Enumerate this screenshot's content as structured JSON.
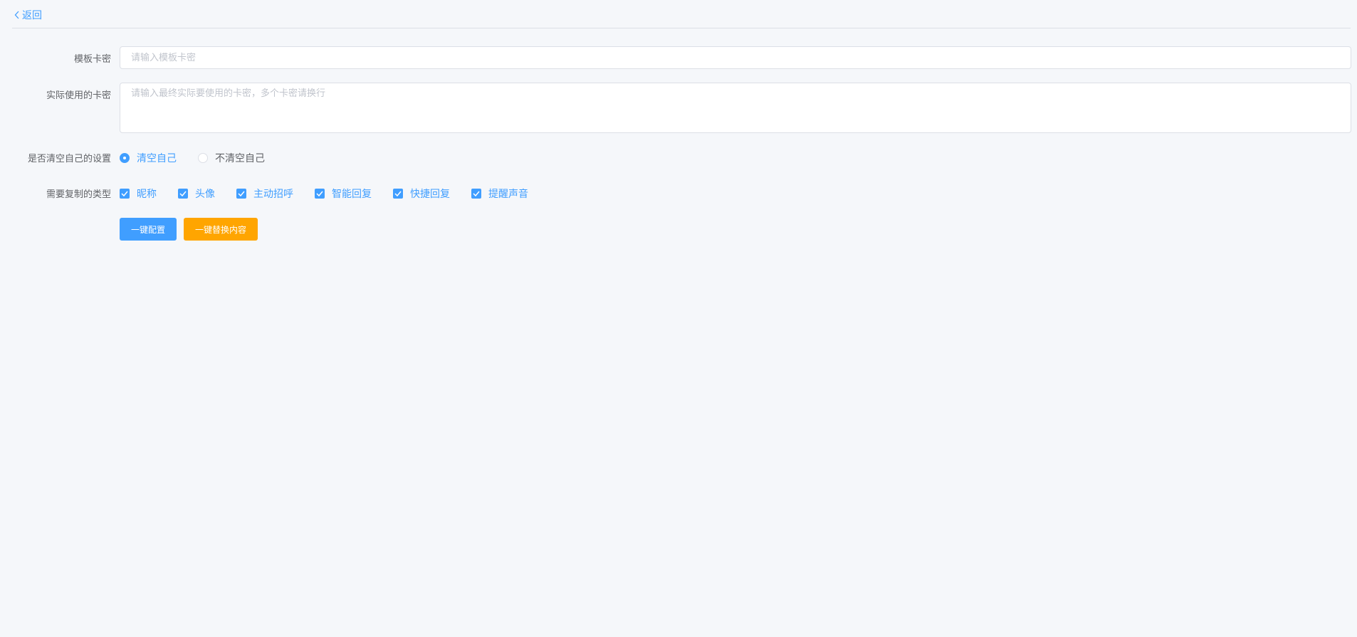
{
  "nav": {
    "back_label": "返回"
  },
  "form": {
    "template_card": {
      "label": "模板卡密",
      "placeholder": "请输入模板卡密",
      "value": ""
    },
    "actual_cards": {
      "label": "实际使用的卡密",
      "placeholder": "请输入最终实际要使用的卡密，多个卡密请换行",
      "value": ""
    },
    "clear_self": {
      "label": "是否清空自己的设置",
      "options": [
        {
          "label": "清空自己",
          "selected": true
        },
        {
          "label": "不清空自己",
          "selected": false
        }
      ]
    },
    "copy_types": {
      "label": "需要复制的类型",
      "options": [
        {
          "label": "昵称",
          "checked": true
        },
        {
          "label": "头像",
          "checked": true
        },
        {
          "label": "主动招呼",
          "checked": true
        },
        {
          "label": "智能回复",
          "checked": true
        },
        {
          "label": "快捷回复",
          "checked": true
        },
        {
          "label": "提醒声音",
          "checked": true
        }
      ]
    }
  },
  "actions": {
    "configure_label": "一键配置",
    "replace_label": "一键替换内容"
  },
  "colors": {
    "primary": "#409eff",
    "warning": "#ffa500",
    "background": "#f5f7fa"
  }
}
